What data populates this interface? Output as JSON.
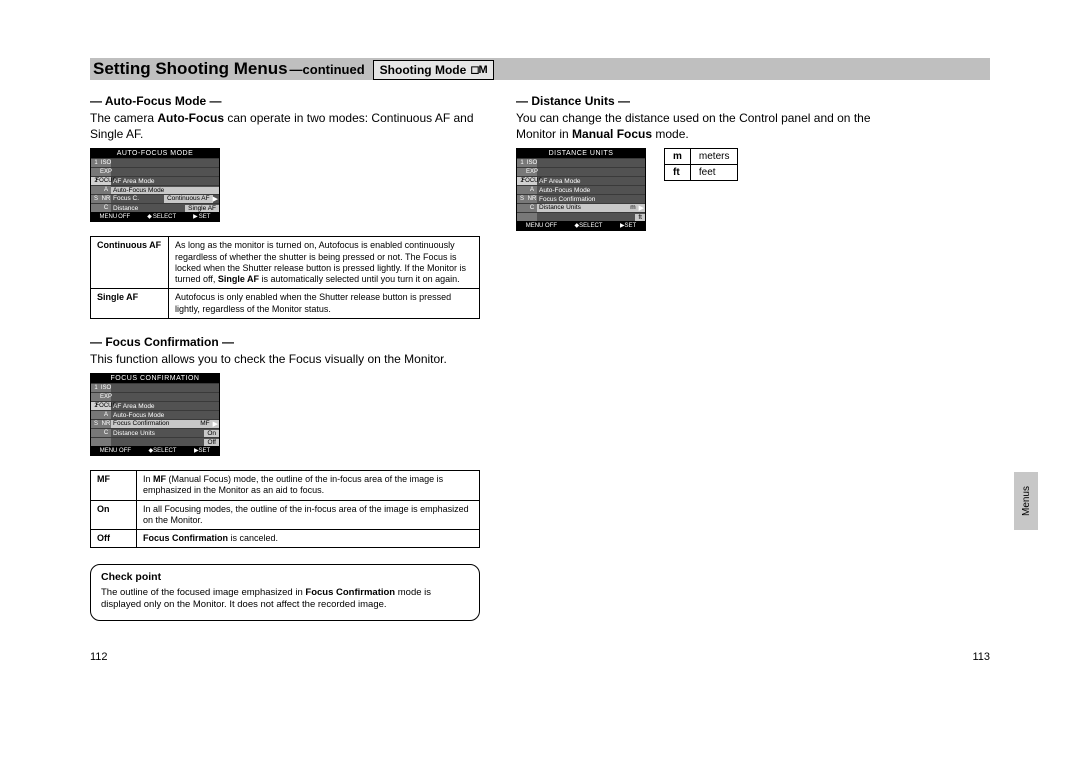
{
  "header": {
    "title": "Setting Shooting Menus",
    "continued": "—continued",
    "mode_box": "Shooting Mode",
    "mode_icons": "📷M"
  },
  "left": {
    "af_mode": {
      "title": "— Auto-Focus Mode —",
      "text_pre": "The camera ",
      "text_b1": "Auto-Focus",
      "text_mid": " can operate in two modes: Continuous AF and Single AF.",
      "lcd": {
        "title": "AUTO-FOCUS MODE",
        "tabs": [
          "1",
          "2",
          "S"
        ],
        "subtabs": [
          "ISO",
          "EXP",
          "FOCUS",
          "A",
          "NR",
          "C"
        ],
        "rows": [
          "AF Area Mode",
          "Auto-Focus Mode",
          "Focus Co Continuous AF",
          "Distance Single AF"
        ],
        "hl_value": "Continuous AF",
        "footer": {
          "off": "OFF",
          "select": "SELECT",
          "set": "SET",
          "menu": "MENU"
        }
      },
      "table": {
        "r1k": "Continuous AF",
        "r1v_a": "As long as the monitor is turned on, Autofocus is enabled continuously regardless of whether the shutter is being pressed or not. The Focus is locked when the Shutter release button is pressed lightly. If the Monitor is turned off, ",
        "r1v_b": "Single AF",
        "r1v_c": " is automatically selected until you turn it on again.",
        "r2k": "Single AF",
        "r2v": "Autofocus is only enabled when the Shutter release button is pressed lightly, regardless of the Monitor status."
      }
    },
    "fc": {
      "title": "— Focus Confirmation —",
      "text": "This function allows you to check the Focus visually on the Monitor.",
      "lcd": {
        "title": "FOCUS CONFIRMATION",
        "rows": [
          "AF Area Mode",
          "Auto-Focus Mode",
          "Focus Confirmation MF",
          "Distance Units   On",
          "                 Off"
        ]
      },
      "table": {
        "r1k": "MF",
        "r1v_a": "In ",
        "r1v_b": "MF",
        "r1v_c": " (Manual Focus) mode, the outline of the in-focus area of the image is emphasized in the Monitor as an aid to focus.",
        "r2k": "On",
        "r2v": "In all Focusing modes, the outline of the in-focus area of the image is emphasized on the Monitor.",
        "r3k": "Off",
        "r3v_b": "Focus Confirmation",
        "r3v_c": " is canceled."
      }
    },
    "checkpoint": {
      "title": "Check point",
      "text_a": "The outline of the focused image emphasized in ",
      "text_b": "Focus Confirmation",
      "text_c": " mode is displayed only on the Monitor. It does not affect the recorded image."
    }
  },
  "right": {
    "du": {
      "title": "— Distance Units —",
      "text_a": "You can change the distance used on the Control panel and on the Monitor in ",
      "text_b": "Manual Focus",
      "text_c": " mode.",
      "lcd": {
        "title": "DISTANCE UNITS",
        "rows": [
          "AF Area Mode",
          "Auto-Focus Mode",
          "Focus Confirmation",
          "Distance Units  m",
          "                ft"
        ]
      },
      "units": {
        "r1k": "m",
        "r1v": "meters",
        "r2k": "ft",
        "r2v": "feet"
      }
    }
  },
  "side_tab": "Menus",
  "page_left": "112",
  "page_right": "113"
}
